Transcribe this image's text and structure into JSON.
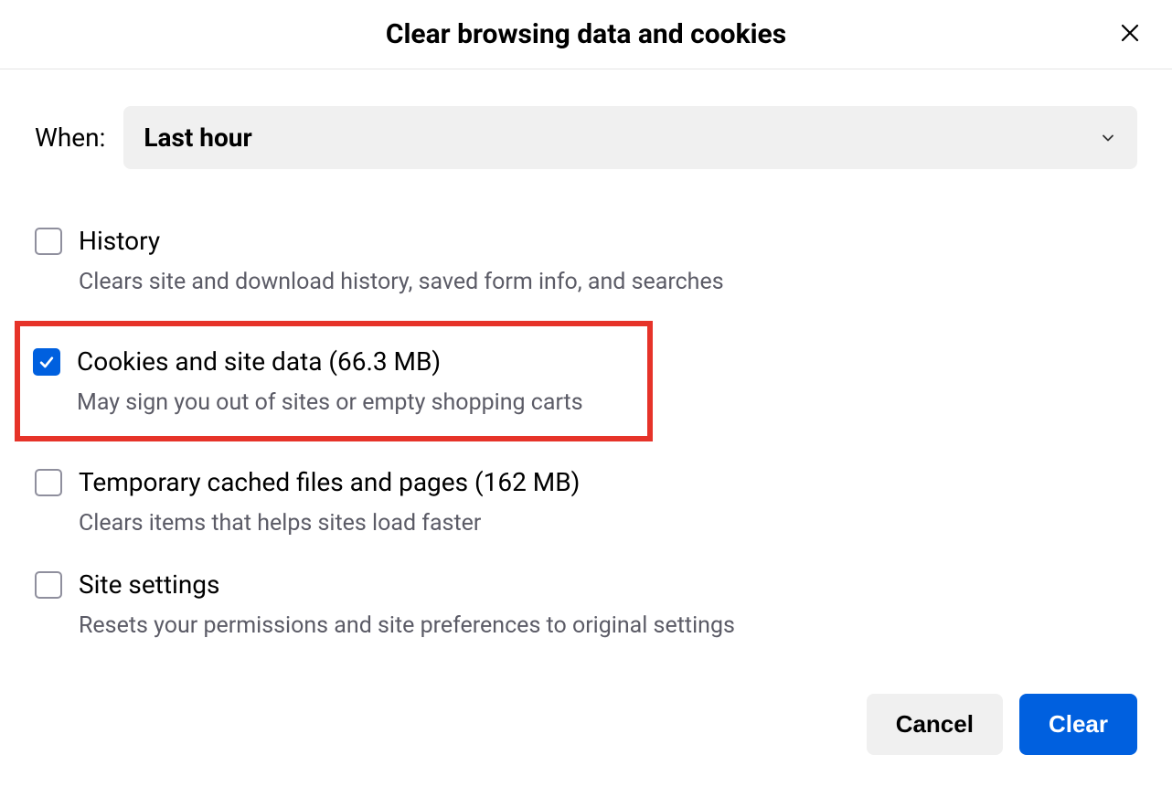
{
  "dialog": {
    "title": "Clear browsing data and cookies",
    "when_label": "When:",
    "when_value": "Last hour",
    "options": [
      {
        "title": "History",
        "desc": "Clears site and download history, saved form info, and searches",
        "checked": false,
        "highlighted": false
      },
      {
        "title": "Cookies and site data (66.3 MB)",
        "desc": "May sign you out of sites or empty shopping carts",
        "checked": true,
        "highlighted": true
      },
      {
        "title": "Temporary cached files and pages (162 MB)",
        "desc": "Clears items that helps sites load faster",
        "checked": false,
        "highlighted": false
      },
      {
        "title": "Site settings",
        "desc": "Resets your permissions and site preferences to original settings",
        "checked": false,
        "highlighted": false
      }
    ],
    "cancel_label": "Cancel",
    "clear_label": "Clear"
  }
}
